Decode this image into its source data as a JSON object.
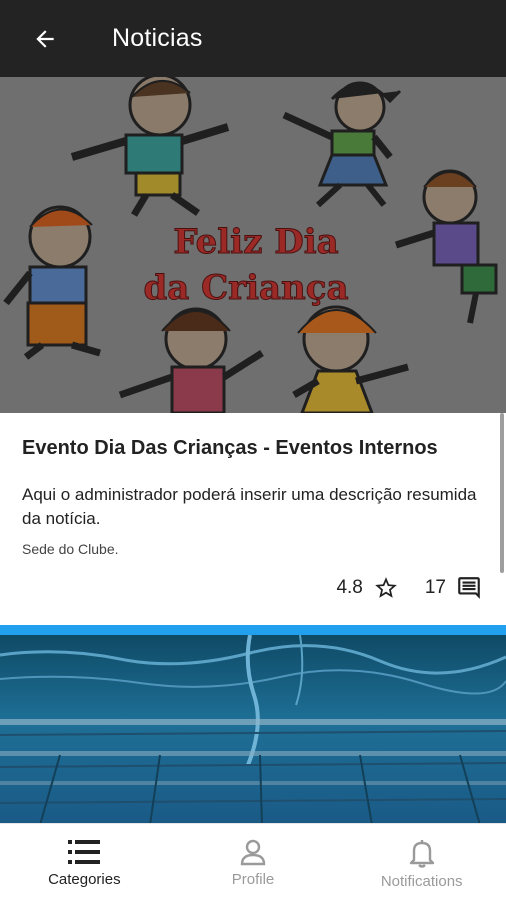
{
  "app_bar": {
    "title": "Noticias",
    "back_icon": "arrow-back-icon"
  },
  "news": [
    {
      "image_icon": "children-illustration",
      "image_text": [
        "Feliz Dia",
        "da Criança"
      ],
      "title": "Evento Dia Das Crianças - Eventos Internos",
      "description": "Aqui o administrador poderá inserir uma descrição resumida da notícia.",
      "location": "Sede do Clube.",
      "rating": "4.8",
      "comments": "17"
    },
    {
      "image_icon": "swimming-pool-photo"
    }
  ],
  "bottom_nav": [
    {
      "label": "Categories",
      "icon": "list-icon",
      "active": true
    },
    {
      "label": "Profile",
      "icon": "person-icon",
      "active": false
    },
    {
      "label": "Notifications",
      "icon": "bell-icon",
      "active": false
    }
  ],
  "colors": {
    "app_bar": "#232323",
    "accent": "#21a0ef",
    "nav_inactive": "#9a9a9a",
    "text_primary": "#222222"
  }
}
